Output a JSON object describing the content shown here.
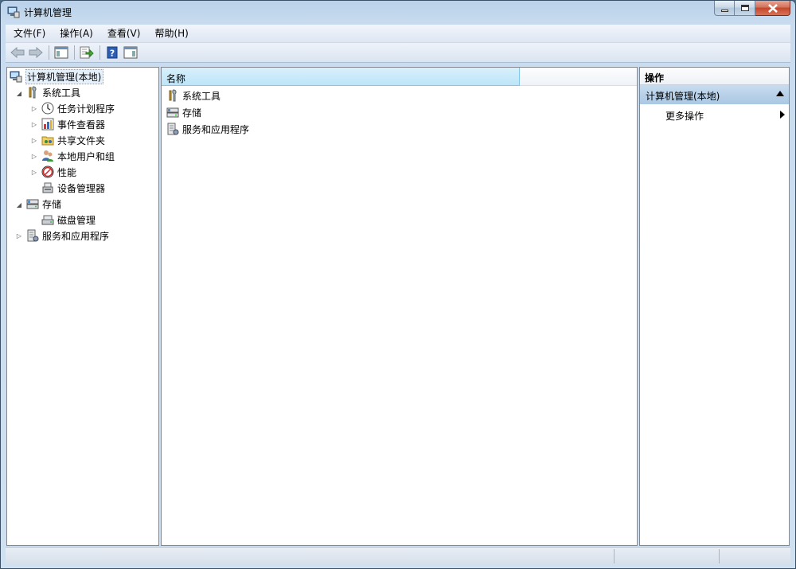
{
  "window": {
    "title": "计算机管理",
    "accent": "#c4462a"
  },
  "menu": {
    "items": [
      {
        "label": "文件(F)"
      },
      {
        "label": "操作(A)"
      },
      {
        "label": "查看(V)"
      },
      {
        "label": "帮助(H)"
      }
    ]
  },
  "toolbar": {
    "buttons": [
      {
        "icon": "back-arrow-icon"
      },
      {
        "icon": "forward-arrow-icon"
      },
      {
        "icon": "show-hide-console-tree-icon"
      },
      {
        "icon": "export-list-icon"
      },
      {
        "icon": "help-icon"
      },
      {
        "icon": "show-hide-action-pane-icon"
      }
    ]
  },
  "tree": {
    "root": "计算机管理(本地)",
    "system_tools": "系统工具",
    "task_scheduler": "任务计划程序",
    "event_viewer": "事件查看器",
    "shared_folders": "共享文件夹",
    "local_users_groups": "本地用户和组",
    "performance": "性能",
    "device_manager": "设备管理器",
    "storage": "存储",
    "disk_management": "磁盘管理",
    "services_apps": "服务和应用程序"
  },
  "center": {
    "column_name": "名称",
    "rows": [
      {
        "label": "系统工具",
        "icon": "tools-icon"
      },
      {
        "label": "存储",
        "icon": "storage-icon"
      },
      {
        "label": "服务和应用程序",
        "icon": "services-icon"
      }
    ]
  },
  "actions": {
    "header": "操作",
    "group_label": "计算机管理(本地)",
    "more_actions": "更多操作"
  }
}
